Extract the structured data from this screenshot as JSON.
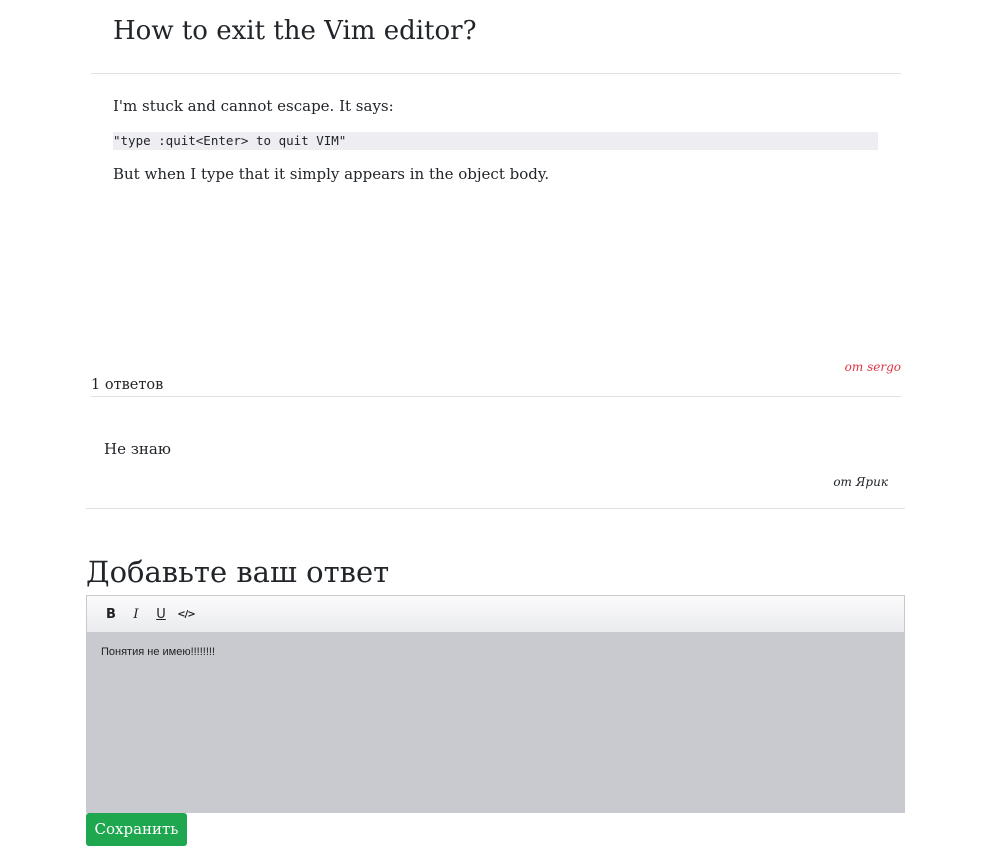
{
  "question": {
    "title": "How to exit the Vim editor?",
    "intro": "I'm stuck and cannot escape. It says:",
    "code": "\"type :quit<Enter> to quit VIM\"",
    "outro": "But when I type that it simply appears in the object body.",
    "author": "от sergo"
  },
  "answers": {
    "count_label": "1 ответов",
    "items": [
      {
        "text": "Не знаю",
        "author": "от Ярик"
      }
    ]
  },
  "reply_form": {
    "title": "Добавьте ваш ответ",
    "toolbar": {
      "bold_label": "B",
      "italic_label": "I",
      "underline_label": "U",
      "code_label": "</>"
    },
    "editor_value": "Понятия не имею!!!!!!!!",
    "save_label": "Сохранить"
  },
  "colors": {
    "author_accent": "#dc3545",
    "save_button": "#1fa750",
    "editor_background": "#c9cacf"
  }
}
